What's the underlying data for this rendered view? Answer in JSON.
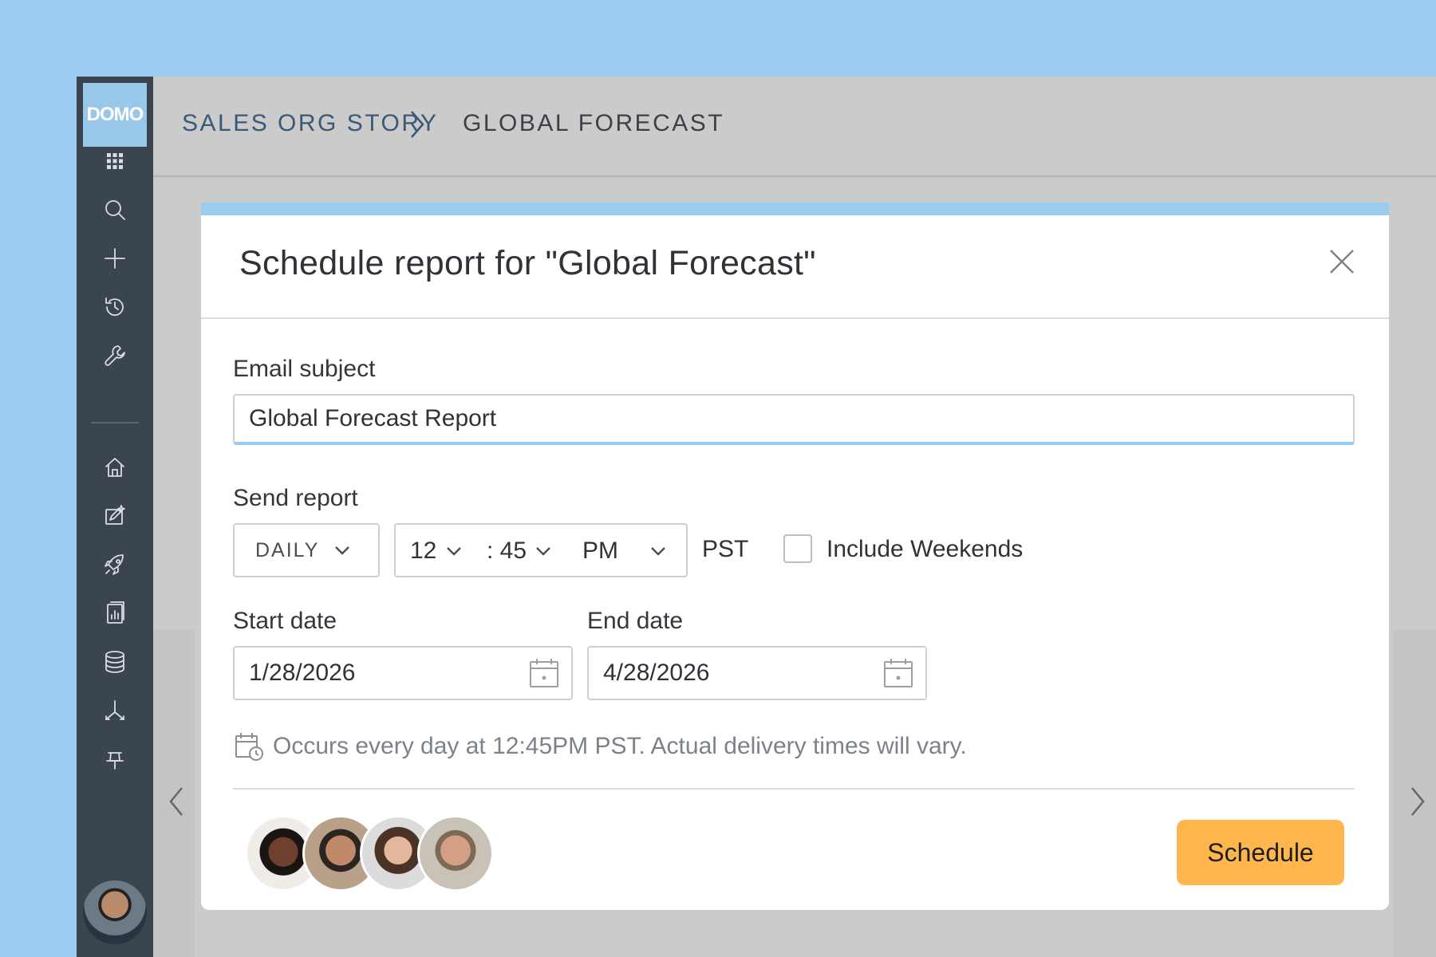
{
  "app": {
    "logo_text": "DOMO"
  },
  "sidebar": {
    "items": [
      {
        "icon": "apps-grid-icon"
      },
      {
        "icon": "search-icon"
      },
      {
        "icon": "plus-icon"
      },
      {
        "icon": "history-icon"
      },
      {
        "icon": "wrench-icon"
      },
      {
        "icon": "home-icon"
      },
      {
        "icon": "edit-sparkle-icon"
      },
      {
        "icon": "rocket-icon"
      },
      {
        "icon": "report-icon"
      },
      {
        "icon": "database-icon"
      },
      {
        "icon": "dataflow-icon"
      },
      {
        "icon": "pin-icon"
      }
    ],
    "user_avatar": "user-avatar"
  },
  "breadcrumb": {
    "parent": "SALES ORG STORY",
    "current": "GLOBAL FORECAST"
  },
  "dialog": {
    "title": "Schedule report for \"Global Forecast\"",
    "email_subject_label": "Email subject",
    "email_subject_value": "Global Forecast Report",
    "send_report_label": "Send report",
    "frequency": "DAILY",
    "hour": "12",
    "minute": ": 45",
    "meridiem": "PM",
    "timezone": "PST",
    "include_weekends_label": "Include Weekends",
    "include_weekends_checked": false,
    "start_date_label": "Start date",
    "start_date_value": "1/28/2026",
    "end_date_label": "End date",
    "end_date_value": "4/28/2026",
    "info_text": "Occurs every day at 12:45PM PST. Actual delivery times will vary.",
    "schedule_button": "Schedule"
  },
  "colors": {
    "background": "#9bcbee",
    "sidebar": "#3a4550",
    "accent_button": "#ffb74d",
    "breadcrumb": "#3b5878"
  }
}
